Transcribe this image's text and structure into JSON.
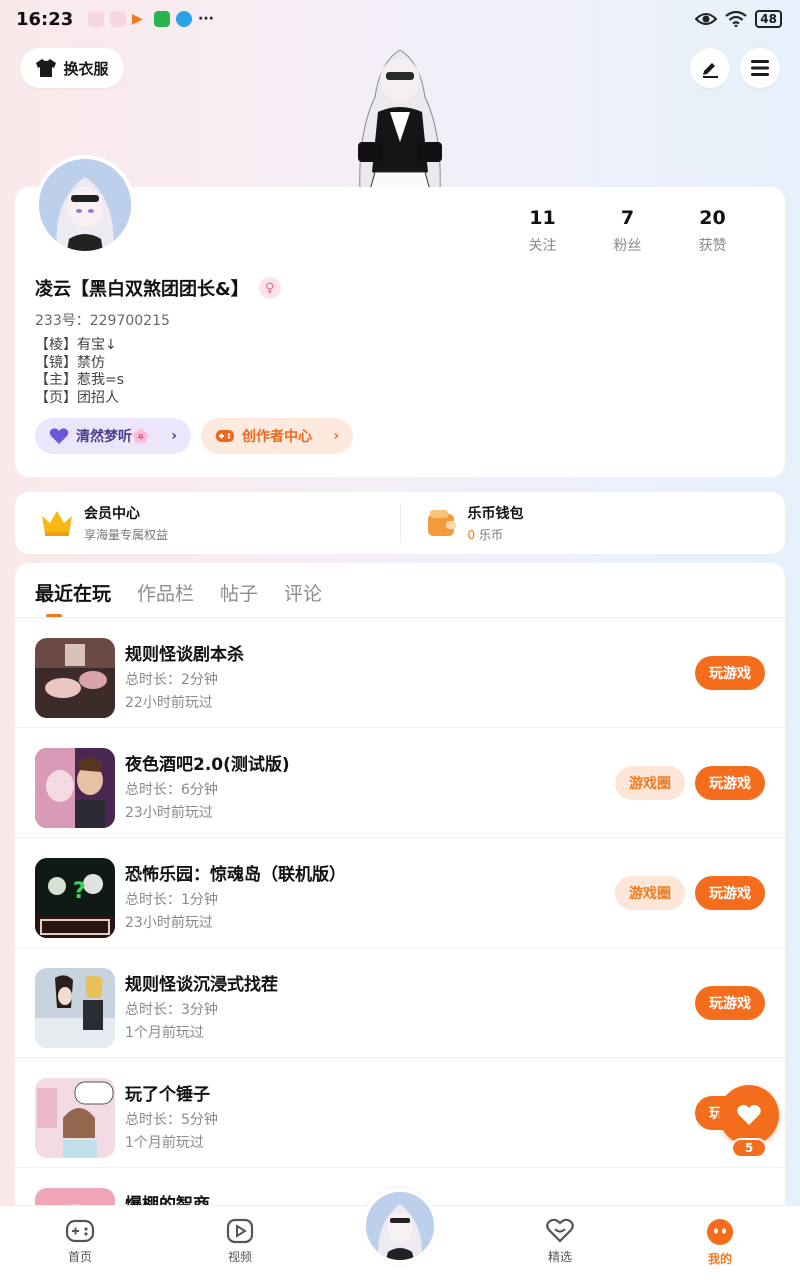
{
  "status_bar": {
    "time": "16:23",
    "battery": "48"
  },
  "header": {
    "outfit_label": "换衣服"
  },
  "profile": {
    "stats": [
      {
        "num": "11",
        "label": "关注"
      },
      {
        "num": "7",
        "label": "粉丝"
      },
      {
        "num": "20",
        "label": "获赞"
      }
    ],
    "nickname": "凌云【黑白双煞团团长&】",
    "uid": "233号：229700215",
    "bio": [
      "【棱】有宝↓",
      "【镜】禁仿",
      "【主】惹我=s",
      "【页】团招人"
    ],
    "tag_dream": "清然梦听🌸",
    "tag_creator": "创作者中心"
  },
  "member": {
    "vip_title": "会员中心",
    "vip_sub": "享海量专属权益",
    "wallet_title": "乐币钱包",
    "wallet_amount": "0",
    "wallet_unit": " 乐币"
  },
  "tabs": [
    "最近在玩",
    "作品栏",
    "帖子",
    "评论"
  ],
  "games": [
    {
      "title": "规则怪谈剧本杀",
      "duration": "总时长：2分钟",
      "last_played": "22小时前玩过",
      "play": "玩游戏"
    },
    {
      "title": "夜色酒吧2.0(测试版)",
      "duration": "总时长：6分钟",
      "last_played": "23小时前玩过",
      "play": "玩游戏",
      "circle": "游戏圈"
    },
    {
      "title": "恐怖乐园：惊魂岛（联机版）",
      "duration": "总时长：1分钟",
      "last_played": "23小时前玩过",
      "play": "玩游戏",
      "circle": "游戏圈"
    },
    {
      "title": "规则怪谈沉浸式找茬",
      "duration": "总时长：3分钟",
      "last_played": "1个月前玩过",
      "play": "玩游戏"
    },
    {
      "title": "玩了个锤子",
      "duration": "总时长：5分钟",
      "last_played": "1个月前玩过",
      "play": "玩游戏"
    },
    {
      "title": "爆棚的智商"
    }
  ],
  "fav_count": "5",
  "nav": {
    "home": "首页",
    "video": "视频",
    "featured": "精选",
    "mine": "我的"
  },
  "colors": {
    "accent": "#f36d1d",
    "accent_light": "#fde6d8",
    "dream_bg": "#ebe6fb"
  }
}
